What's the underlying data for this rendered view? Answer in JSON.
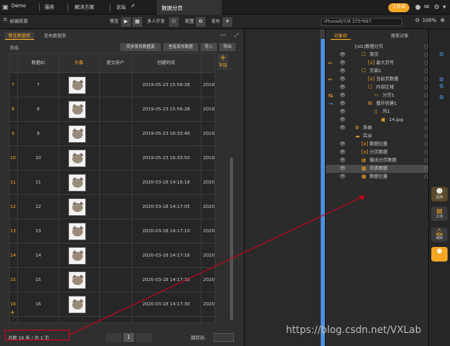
{
  "topbar": {
    "menus": [
      "Demo",
      "服务",
      "解决方案",
      "论坛"
    ],
    "page_tab": "数据分页",
    "workspace_btn": "工作台",
    "colors": {
      "accent": "#f5a623",
      "link": "#4a90e2",
      "annotation": "#d0021b"
    }
  },
  "secbar": {
    "breadcrumb": "前端资源",
    "preview": "预览",
    "multi_dev": "多人开发",
    "config": "配置",
    "publish": "发布",
    "device": "iPhone6/7/8 375*667",
    "zoom": "100%"
  },
  "leftpanel": {
    "tabs": [
      "预览数据表",
      "发布数据表"
    ],
    "section_label": "表格",
    "buttons": [
      "同步发布数据源",
      "查看发布数据",
      "导入",
      "导出"
    ],
    "add_column": "字段",
    "columns": [
      "数据ID",
      "头像",
      "提交用户",
      "创建时间"
    ],
    "rows": [
      {
        "n": "7",
        "id": "7",
        "time": "2019-05-23 15:56:28",
        "cut": "2019"
      },
      {
        "n": "8",
        "id": "8",
        "time": "2019-05-23 15:56:28",
        "cut": "2019"
      },
      {
        "n": "9",
        "id": "9",
        "time": "2019-05-23 16:33:49",
        "cut": "2019"
      },
      {
        "n": "10",
        "id": "10",
        "time": "2019-05-23 16:33:50",
        "cut": "2019"
      },
      {
        "n": "11",
        "id": "11",
        "time": "2020-03-18 14:16:18",
        "cut": "2020"
      },
      {
        "n": "12",
        "id": "12",
        "time": "2020-03-18 14:17:05",
        "cut": "2020"
      },
      {
        "n": "13",
        "id": "13",
        "time": "2020-03-18 14:17:10",
        "cut": "2020"
      },
      {
        "n": "14",
        "id": "14",
        "time": "2020-03-18 14:17:16",
        "cut": "2020"
      },
      {
        "n": "15",
        "id": "15",
        "time": "2020-03-18 14:17:23",
        "cut": "2020"
      },
      {
        "n": "16",
        "id": "16",
        "time": "2020-03-18 14:17:30",
        "cut": "2020"
      }
    ],
    "footer_total": "总数 16 条 / 共 1 页",
    "page_current": "1",
    "jump_label": "跳转到:"
  },
  "rightpanel": {
    "tabs": [
      "对象树",
      "搜索对象"
    ],
    "tree": [
      {
        "label": "[id1]数据分页",
        "indent": 36,
        "icon": ""
      },
      {
        "label": "首页",
        "indent": 44,
        "icon": "☐"
      },
      {
        "label": "最大页号",
        "indent": 52,
        "icon": "[x]"
      },
      {
        "label": "页面1",
        "indent": 44,
        "icon": "☐"
      },
      {
        "label": "当前页数据",
        "indent": 52,
        "icon": "[x]"
      },
      {
        "label": "内部区域",
        "indent": 52,
        "icon": "☐"
      },
      {
        "label": "分页1",
        "indent": 60,
        "icon": "‹›"
      },
      {
        "label": "循环创建1",
        "indent": 52,
        "icon": "⊞"
      },
      {
        "label": "列1",
        "indent": 60,
        "icon": "▯"
      },
      {
        "label": "14.jpg",
        "indent": 68,
        "icon": "▣"
      },
      {
        "label": "系统",
        "indent": 36,
        "icon": "⚙"
      },
      {
        "label": "后台",
        "indent": 36,
        "icon": "☁"
      },
      {
        "label": "数据位量",
        "indent": 44,
        "icon": "[x]"
      },
      {
        "label": "分页数据",
        "indent": 44,
        "icon": "[x]"
      },
      {
        "label": "输出分页数据",
        "indent": 44,
        "icon": "▤"
      },
      {
        "label": "列表数据",
        "indent": 44,
        "icon": "▦"
      },
      {
        "label": "数据位量",
        "indent": 44,
        "icon": "▦"
      }
    ]
  },
  "sidebar": {
    "buttons": [
      "选择",
      "工单",
      "通知"
    ]
  },
  "watermark": "https://blog.csdn.net/VXLab"
}
